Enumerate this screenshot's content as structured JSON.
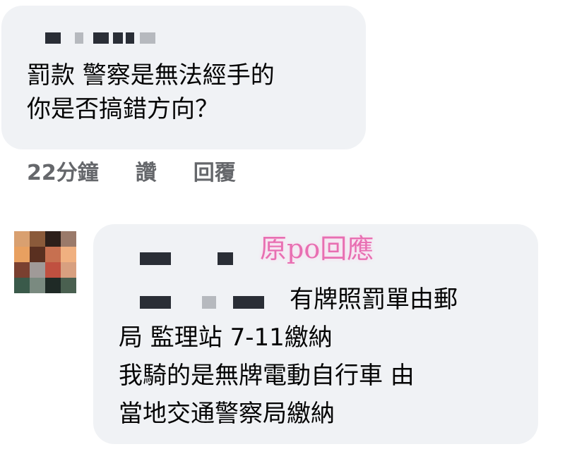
{
  "comment1": {
    "text_lines": [
      "罰款 警察是無法經手的",
      "你是否搞錯方向？"
    ],
    "timestamp": "22分鐘",
    "like_label": "讚",
    "reply_label": "回覆"
  },
  "comment2": {
    "annotation": "原po回應",
    "first_line_text": "有牌照罰單由郵",
    "text_lines": [
      "局 監理站 7-11繳納",
      "我騎的是無牌電動自行車 由",
      "當地交通警察局繳納"
    ]
  },
  "colors": {
    "bubble_bg": "#f0f2f5",
    "meta_text": "#65676b",
    "annotation_pink": "#e86fb2"
  }
}
